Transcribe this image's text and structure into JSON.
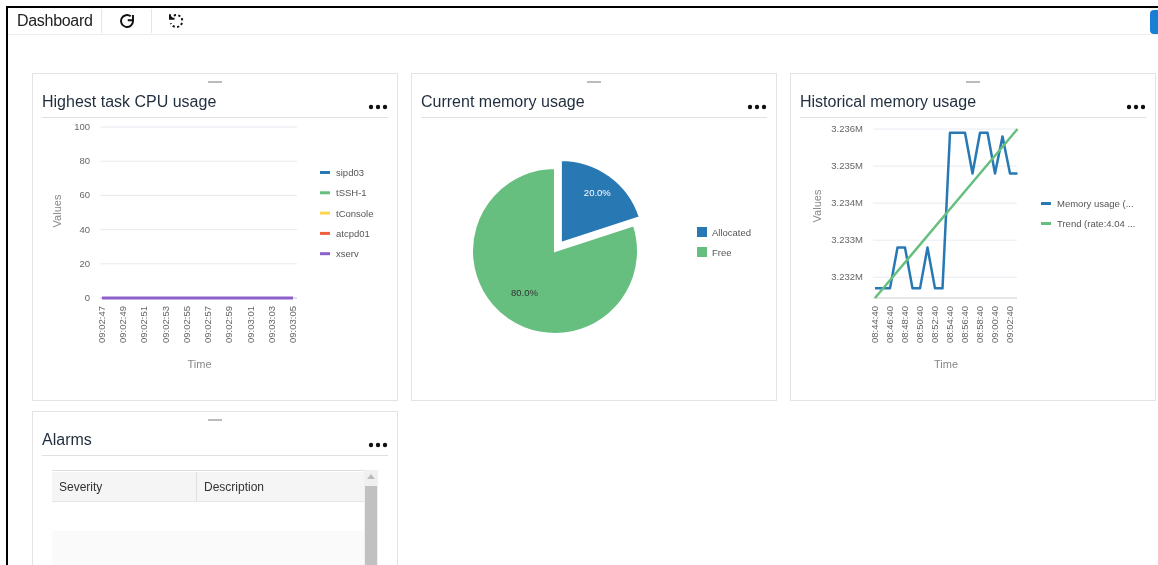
{
  "toolbar": {
    "title": "Dashboard"
  },
  "widgets": [
    {
      "kind": "chart",
      "title": "Highest task CPU usage",
      "chart_data": {
        "type": "line",
        "xlabel": "Time",
        "ylabel": "Values",
        "grid": true,
        "legend": "right",
        "categories": [
          "09:02:47",
          "09:02:49",
          "09:02:51",
          "09:02:53",
          "09:02:55",
          "09:02:57",
          "09:02:59",
          "09:03:01",
          "09:03:03",
          "09:03:05"
        ],
        "ylim": [
          0,
          100
        ],
        "yticks": [
          0,
          20,
          40,
          60,
          80,
          100
        ],
        "series": [
          {
            "name": "sipd03",
            "color": "#2878b4",
            "values": [
              null,
              null,
              null,
              null,
              null,
              null,
              null,
              null,
              null,
              null
            ]
          },
          {
            "name": "tSSH-1",
            "color": "#66bf7f",
            "values": [
              null,
              null,
              null,
              null,
              null,
              null,
              null,
              null,
              null,
              null
            ]
          },
          {
            "name": "tConsole",
            "color": "#fdd64f",
            "values": [
              null,
              null,
              null,
              null,
              null,
              null,
              null,
              null,
              null,
              null
            ]
          },
          {
            "name": "atcpd01",
            "color": "#f0603e",
            "values": [
              null,
              null,
              null,
              null,
              null,
              null,
              null,
              null,
              null,
              null
            ]
          },
          {
            "name": "xserv",
            "color": "#8e60cc",
            "values": [
              0,
              0,
              0,
              0,
              0,
              0,
              0,
              0,
              0,
              0
            ]
          }
        ]
      }
    },
    {
      "kind": "chart",
      "title": "Current memory usage",
      "chart_data": {
        "type": "pie",
        "legend": "right",
        "categories": [
          "Allocated",
          "Free"
        ],
        "values": [
          20,
          80
        ],
        "colors": [
          "#2878b4",
          "#66bf7f"
        ],
        "value_labels": [
          "20.0%",
          "80.0%"
        ]
      }
    },
    {
      "kind": "chart",
      "title": "Historical memory usage",
      "chart_data": {
        "type": "line",
        "xlabel": "Time",
        "ylabel": "Values",
        "grid": true,
        "legend": "right",
        "categories": [
          "08:44:40",
          null,
          "08:46:40",
          null,
          "08:48:40",
          null,
          "08:50:40",
          null,
          "08:52:40",
          null,
          "08:54:40",
          null,
          "08:56:40",
          null,
          "08:58:40",
          null,
          "09:00:40",
          null,
          "09:02:40",
          null
        ],
        "ylim": [
          3.23144,
          3.236
        ],
        "yticks": [
          {
            "value": 3.232,
            "label": "3.232M"
          },
          {
            "value": 3.233,
            "label": "3.233M"
          },
          {
            "value": 3.234,
            "label": "3.234M"
          },
          {
            "value": 3.235,
            "label": "3.235M"
          },
          {
            "value": 3.236,
            "label": "3.236M"
          }
        ],
        "series": [
          {
            "name": "Memory usage (...",
            "color": "#2878b4",
            "values": [
              3.2317,
              3.2317,
              3.2317,
              3.2328,
              3.2328,
              3.2317,
              3.2317,
              3.2328,
              3.2317,
              3.2317,
              3.2359,
              3.2359,
              3.2359,
              3.2348,
              3.2359,
              3.2359,
              3.2348,
              3.2358,
              3.2348,
              3.2348
            ]
          },
          {
            "name": "Trend (rate:4.04 ...",
            "color": "#66bf7f",
            "values": [
              3.23144,
              null,
              null,
              null,
              null,
              null,
              null,
              null,
              null,
              null,
              null,
              null,
              null,
              null,
              null,
              null,
              null,
              null,
              null,
              3.236
            ]
          }
        ]
      }
    },
    {
      "kind": "table",
      "title": "Alarms",
      "columns": [
        "Severity",
        "Description"
      ]
    }
  ]
}
